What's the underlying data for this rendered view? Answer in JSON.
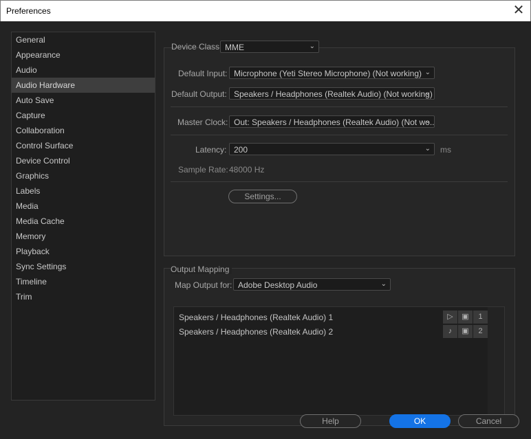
{
  "window": {
    "title": "Preferences"
  },
  "sidebar": {
    "items": [
      {
        "label": "General"
      },
      {
        "label": "Appearance"
      },
      {
        "label": "Audio"
      },
      {
        "label": "Audio Hardware"
      },
      {
        "label": "Auto Save"
      },
      {
        "label": "Capture"
      },
      {
        "label": "Collaboration"
      },
      {
        "label": "Control Surface"
      },
      {
        "label": "Device Control"
      },
      {
        "label": "Graphics"
      },
      {
        "label": "Labels"
      },
      {
        "label": "Media"
      },
      {
        "label": "Media Cache"
      },
      {
        "label": "Memory"
      },
      {
        "label": "Playback"
      },
      {
        "label": "Sync Settings"
      },
      {
        "label": "Timeline"
      },
      {
        "label": "Trim"
      }
    ],
    "active_index": 3
  },
  "device": {
    "class_label": "Device Class:",
    "class_value": "MME",
    "default_input_label": "Default Input:",
    "default_input_value": "Microphone (Yeti Stereo Microphone) (Not working)",
    "default_output_label": "Default Output:",
    "default_output_value": "Speakers / Headphones (Realtek Audio) (Not working)",
    "master_clock_label": "Master Clock:",
    "master_clock_value": "Out: Speakers / Headphones (Realtek Audio) (Not wo...",
    "latency_label": "Latency:",
    "latency_value": "200",
    "latency_unit": "ms",
    "sample_rate_label": "Sample Rate:",
    "sample_rate_value": "48000 Hz",
    "settings_button": "Settings..."
  },
  "output_mapping": {
    "title": "Output Mapping",
    "map_for_label": "Map Output for:",
    "map_for_value": "Adobe Desktop Audio",
    "rows": [
      {
        "label": "Speakers / Headphones (Realtek Audio) 1",
        "channel": "1"
      },
      {
        "label": "Speakers / Headphones (Realtek Audio) 2",
        "channel": "2"
      }
    ]
  },
  "footer": {
    "help": "Help",
    "ok": "OK",
    "cancel": "Cancel"
  },
  "colors": {
    "accent": "#1473e6",
    "background": "#232323"
  }
}
